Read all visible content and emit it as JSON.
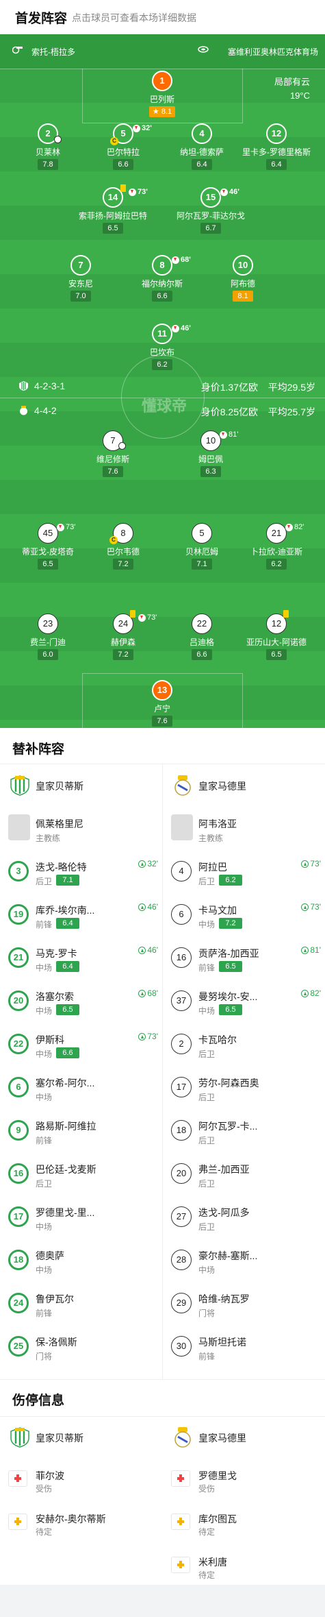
{
  "header": {
    "title": "首发阵容",
    "subtitle": "点击球员可查看本场详细数据"
  },
  "pitch_info": {
    "referee": "索托-梧拉多",
    "stadium": "塞维利亚奥林匹克体育场",
    "weather": "局部有云",
    "temperature": "19°C",
    "logo": "懂球帝"
  },
  "home": {
    "formation": "4-2-3-1",
    "value": "身价1.37亿欧",
    "age": "平均29.5岁",
    "players": [
      {
        "num": "1",
        "name": "巴列斯",
        "rating": "8.1",
        "hi": true
      },
      {
        "num": "2",
        "name": "贝莱林",
        "rating": "7.8"
      },
      {
        "num": "5",
        "name": "巴尔特拉",
        "rating": "6.6",
        "sub": "32'"
      },
      {
        "num": "4",
        "name": "纳坦-德索萨",
        "rating": "6.4"
      },
      {
        "num": "12",
        "name": "里卡多-罗德里格斯",
        "rating": "6.4"
      },
      {
        "num": "14",
        "name": "索菲扬-阿姆拉巴特",
        "rating": "6.5",
        "sub": "73'"
      },
      {
        "num": "15",
        "name": "阿尔瓦罗-菲达尔戈",
        "rating": "6.7",
        "sub": "46'"
      },
      {
        "num": "7",
        "name": "安东尼",
        "rating": "7.0"
      },
      {
        "num": "8",
        "name": "福尔纳尔斯",
        "rating": "6.6",
        "sub": "68'"
      },
      {
        "num": "10",
        "name": "阿布德",
        "rating": "8.1",
        "hi": true
      },
      {
        "num": "11",
        "name": "巴坎布",
        "rating": "6.2",
        "sub": "46'"
      }
    ]
  },
  "away": {
    "formation": "4-4-2",
    "value": "身价8.25亿欧",
    "age": "平均25.7岁",
    "players": [
      {
        "num": "7",
        "name": "维尼修斯",
        "rating": "7.6"
      },
      {
        "num": "10",
        "name": "姆巴佩",
        "rating": "6.3",
        "sub": "81'"
      },
      {
        "num": "45",
        "name": "蒂亚戈-皮塔奇",
        "rating": "6.5",
        "sub": "73'"
      },
      {
        "num": "8",
        "name": "巴尔韦德",
        "rating": "7.2"
      },
      {
        "num": "5",
        "name": "贝林厄姆",
        "rating": "7.1"
      },
      {
        "num": "21",
        "name": "卜拉欣-迪亚斯",
        "rating": "6.2",
        "sub": "82'"
      },
      {
        "num": "23",
        "name": "费兰-门迪",
        "rating": "6.0"
      },
      {
        "num": "24",
        "name": "赫伊森",
        "rating": "7.2",
        "sub": "73'"
      },
      {
        "num": "22",
        "name": "吕迪格",
        "rating": "6.6"
      },
      {
        "num": "12",
        "name": "亚历山大-阿诺德",
        "rating": "6.5"
      },
      {
        "num": "13",
        "name": "卢宁",
        "rating": "7.6"
      }
    ]
  },
  "subs": {
    "title": "替补阵容",
    "home_team": "皇家贝蒂斯",
    "away_team": "皇家马德里",
    "home_coach": {
      "name": "佩莱格里尼",
      "role": "主教练"
    },
    "away_coach": {
      "name": "阿韦洛亚",
      "role": "主教练"
    },
    "home": [
      {
        "num": "3",
        "name": "迭戈-略伦特",
        "pos": "后卫",
        "rating": "7.1",
        "in": "32'"
      },
      {
        "num": "19",
        "name": "库乔-埃尔南...",
        "pos": "前锋",
        "rating": "6.4",
        "in": "46'"
      },
      {
        "num": "21",
        "name": "马克-罗卡",
        "pos": "中场",
        "rating": "6.4",
        "in": "46'"
      },
      {
        "num": "20",
        "name": "洛塞尔索",
        "pos": "中场",
        "rating": "6.5",
        "in": "68'"
      },
      {
        "num": "22",
        "name": "伊斯科",
        "pos": "中场",
        "rating": "6.6",
        "in": "73'"
      },
      {
        "num": "6",
        "name": "塞尔希-阿尔...",
        "pos": "中场"
      },
      {
        "num": "9",
        "name": "路易斯-阿维拉",
        "pos": "前锋"
      },
      {
        "num": "16",
        "name": "巴伦廷-戈麦斯",
        "pos": "后卫"
      },
      {
        "num": "17",
        "name": "罗德里戈-里...",
        "pos": "中场"
      },
      {
        "num": "18",
        "name": "德奥萨",
        "pos": "中场"
      },
      {
        "num": "24",
        "name": "鲁伊瓦尔",
        "pos": "前锋"
      },
      {
        "num": "25",
        "name": "保-洛佩斯",
        "pos": "门将"
      }
    ],
    "away": [
      {
        "num": "4",
        "name": "阿拉巴",
        "pos": "后卫",
        "rating": "6.2",
        "in": "73'"
      },
      {
        "num": "6",
        "name": "卡马文加",
        "pos": "中场",
        "rating": "7.2",
        "in": "73'"
      },
      {
        "num": "16",
        "name": "贡萨洛-加西亚",
        "pos": "前锋",
        "rating": "6.5",
        "in": "81'"
      },
      {
        "num": "37",
        "name": "曼努埃尔-安...",
        "pos": "中场",
        "rating": "6.5",
        "in": "82'"
      },
      {
        "num": "2",
        "name": "卡瓦哈尔",
        "pos": "后卫"
      },
      {
        "num": "17",
        "name": "劳尔-阿森西奥",
        "pos": "后卫"
      },
      {
        "num": "18",
        "name": "阿尔瓦罗-卡...",
        "pos": "后卫"
      },
      {
        "num": "20",
        "name": "弗兰-加西亚",
        "pos": "后卫"
      },
      {
        "num": "27",
        "name": "迭戈-阿瓜多",
        "pos": "后卫"
      },
      {
        "num": "28",
        "name": "豪尔赫-塞斯...",
        "pos": "中场"
      },
      {
        "num": "29",
        "name": "哈维-纳瓦罗",
        "pos": "门将"
      },
      {
        "num": "30",
        "name": "马斯坦托诺",
        "pos": "前锋"
      }
    ]
  },
  "injuries": {
    "title": "伤停信息",
    "home_team": "皇家贝蒂斯",
    "away_team": "皇家马德里",
    "home": [
      {
        "name": "菲尔波",
        "status": "受伤"
      },
      {
        "name": "安赫尔-奥尔蒂斯",
        "status": "待定"
      }
    ],
    "away": [
      {
        "name": "罗德里戈",
        "status": "受伤"
      },
      {
        "name": "库尔图瓦",
        "status": "待定"
      },
      {
        "name": "米利唐",
        "status": "待定"
      }
    ]
  }
}
